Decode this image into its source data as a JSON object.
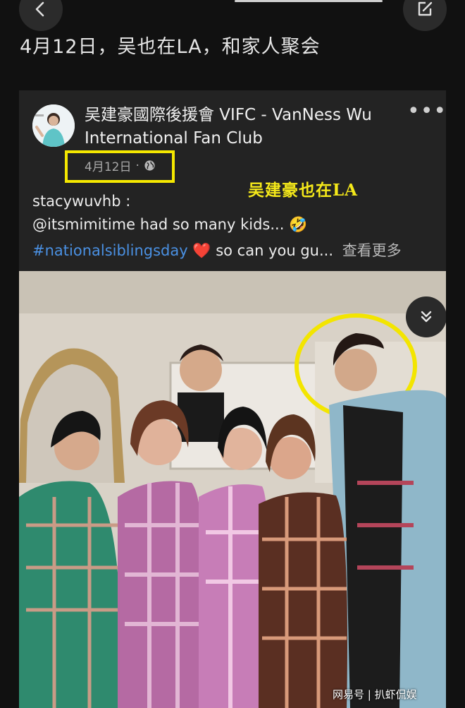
{
  "headline": "4月12日，吴也在LA，和家人聚会",
  "post": {
    "author": "吴建豪國際後援會 VIFC - VanNess Wu International Fan Club",
    "date": "4月12日",
    "dot": "·",
    "more_label": "•••",
    "caption": {
      "line1": "stacywuvhb :",
      "line2": "@itsmimitime had so many kids... 🤣",
      "hashtag": "#nationalsiblingsday",
      "heart": "❤️",
      "line3_rest": " so can you gu...",
      "see_more": "查看更多"
    }
  },
  "annotation": "吴建豪也在LA",
  "watermark": "网易号 | 扒虾侃娱",
  "colors": {
    "highlight": "#f5e800",
    "hashtag": "#4a90e2",
    "background": "#111111",
    "card": "#232323"
  },
  "icons": [
    "chevron-left-icon",
    "share-icon",
    "globe-icon",
    "double-chevron-down-icon"
  ]
}
